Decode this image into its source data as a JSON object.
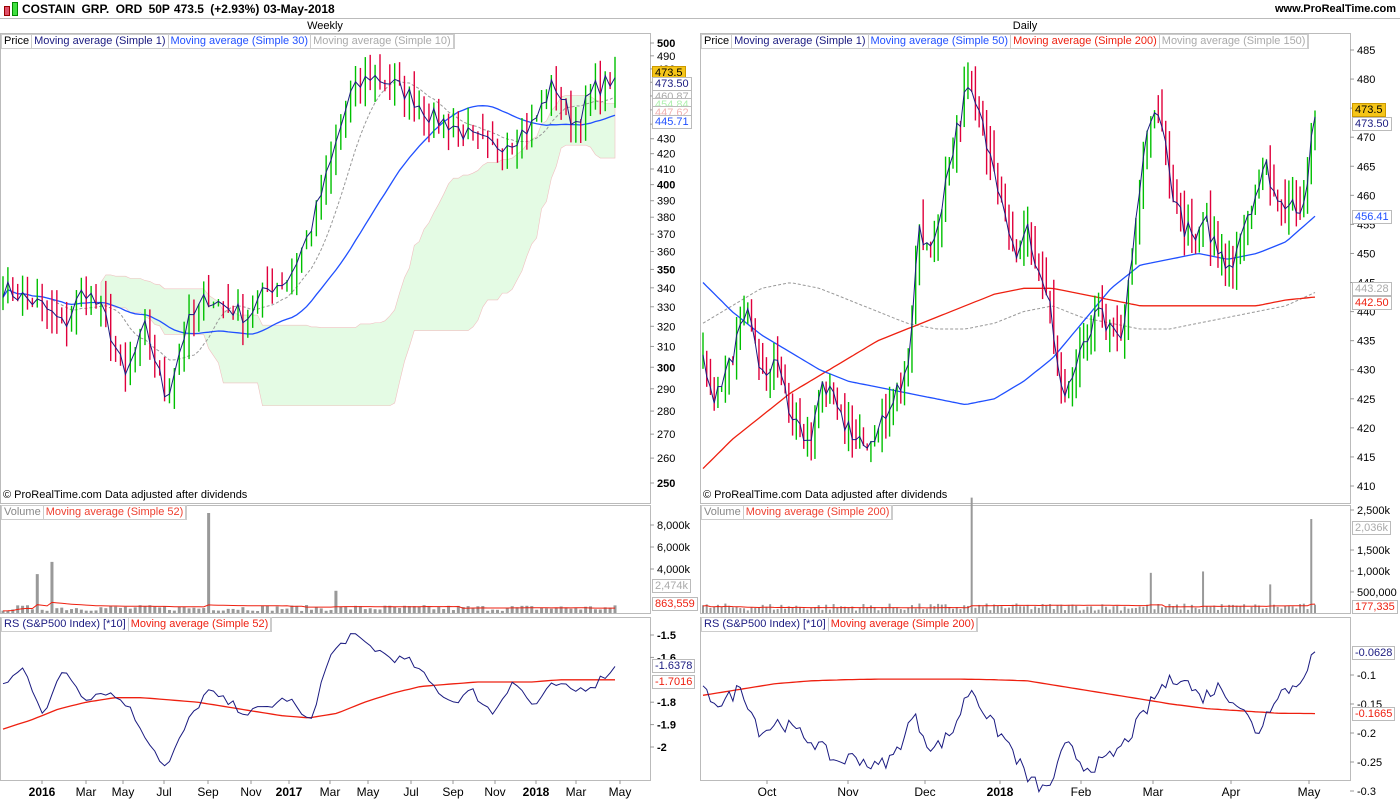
{
  "header": {
    "title": "COSTAIN GRP. ORD 50P",
    "price": "473.5 (+2.93%)",
    "date": "03-May-2018",
    "site": "www.ProRealTime.com"
  },
  "colors": {
    "up": "#00c000",
    "down": "#e0003c",
    "ma1": "#1a1a80",
    "blue": "#2050ff",
    "red": "#ee2010",
    "gray": "#999999",
    "cloud": "#e4fbe4",
    "cloud_red": "#fbe4e4",
    "last": "#f5c518"
  },
  "weekly": {
    "title": "Weekly",
    "legend": [
      "Price",
      "Moving average (Simple 1)",
      "Moving average (Simple 30)",
      "Moving average (Simple 10)"
    ],
    "copyright": "© ProRealTime.com  Data adjusted after dividends",
    "price_ticks": [
      500,
      490,
      480,
      470,
      460,
      450,
      440,
      430,
      420,
      410,
      400,
      390,
      380,
      370,
      360,
      350,
      340,
      330,
      320,
      310,
      300,
      290,
      280,
      270,
      260,
      250
    ],
    "tags": {
      "last": "473.5",
      "ma1": "473.50",
      "ma10": "460.87",
      "span_a": "454.84",
      "span_b": "447.62",
      "ma30": "445.71"
    },
    "volume_legend": [
      "Volume",
      "Moving average (Simple 52)"
    ],
    "volume_ticks": [
      "8,000k",
      "6,000k",
      "4,000k"
    ],
    "volume_tags": {
      "last": "2,474k",
      "ma": "863,559"
    },
    "rs_legend": [
      "RS (S&P500 Index) [*10]",
      "Moving average (Simple 52)"
    ],
    "rs_ticks": [
      "-1.5",
      "-1.6",
      "-1.8",
      "-1.9",
      "-2"
    ],
    "rs_tags": {
      "rs": "-1.6378",
      "ma": "-1.7016"
    },
    "x_labels": [
      "2016",
      "Mar",
      "May",
      "Jul",
      "Sep",
      "Nov",
      "2017",
      "Mar",
      "May",
      "Jul",
      "Sep",
      "Nov",
      "2018",
      "Mar",
      "May"
    ]
  },
  "daily": {
    "title": "Daily",
    "legend": [
      "Price",
      "Moving average (Simple 1)",
      "Moving average (Simple 50)",
      "Moving average (Simple 200)",
      "Moving average (Simple 150)"
    ],
    "copyright": "© ProRealTime.com  Data adjusted after dividends",
    "price_ticks": [
      485,
      480,
      475,
      470,
      465,
      460,
      455,
      450,
      445,
      440,
      435,
      430,
      425,
      420,
      415,
      410
    ],
    "tags": {
      "last": "473.5",
      "ma1": "473.50",
      "ma50": "456.41",
      "ma150": "443.28",
      "ma200": "442.50"
    },
    "volume_legend": [
      "Volume",
      "Moving average (Simple 200)"
    ],
    "volume_ticks": [
      "2,500k",
      "1,500k",
      "1,000k",
      "500,000"
    ],
    "volume_tags": {
      "last": "2,036k",
      "ma": "177,335"
    },
    "rs_legend": [
      "RS (S&P500 Index) [*10]",
      "Moving average (Simple 200)"
    ],
    "rs_ticks": [
      "-0.1",
      "-0.15",
      "-0.2",
      "-0.25",
      "-0.3"
    ],
    "rs_tags": {
      "rs": "-0.0628",
      "ma": "-0.1665"
    },
    "x_labels": [
      "Oct",
      "Nov",
      "Dec",
      "2018",
      "Feb",
      "Mar",
      "Apr",
      "May"
    ]
  },
  "chart_data": [
    {
      "type": "candlestick",
      "name": "weekly",
      "scale": "log",
      "ylim": [
        250,
        500
      ],
      "closes_monthly": [
        340,
        335,
        330,
        320,
        340,
        325,
        295,
        320,
        285,
        320,
        335,
        330,
        325,
        340,
        345,
        370,
        410,
        460,
        475,
        470,
        460,
        445,
        440,
        430,
        425,
        430,
        440,
        470,
        440,
        465,
        473.5
      ],
      "ma30_last": 445.71,
      "ma10_last": 460.87,
      "volume_ylim": [
        0,
        9000000
      ],
      "volume_spikes": {
        "7": 3500000,
        "10": 4600000,
        "42": 9000000,
        "68": 2000000,
        "130": 2474000
      },
      "rs": [
        -1.72,
        -1.65,
        -1.85,
        -1.65,
        -1.78,
        -1.75,
        -1.8,
        -1.95,
        -2.1,
        -1.9,
        -1.75,
        -1.8,
        -1.85,
        -1.82,
        -1.78,
        -1.9,
        -1.6,
        -1.5,
        -1.55,
        -1.6,
        -1.62,
        -1.72,
        -1.8,
        -1.75,
        -1.85,
        -1.7,
        -1.82,
        -1.72,
        -1.75,
        -1.72,
        -1.64
      ],
      "rs_ma": [
        -1.92,
        -1.88,
        -1.83,
        -1.8,
        -1.78,
        -1.78,
        -1.79,
        -1.8,
        -1.82,
        -1.84,
        -1.86,
        -1.87,
        -1.85,
        -1.8,
        -1.76,
        -1.73,
        -1.72,
        -1.71,
        -1.71,
        -1.71,
        -1.7,
        -1.7,
        -1.7
      ]
    },
    {
      "type": "candlestick",
      "name": "daily",
      "scale": "linear",
      "ylim": [
        408,
        487
      ],
      "closes": [
        432,
        425,
        430,
        436,
        440,
        428,
        432,
        425,
        420,
        418,
        428,
        424,
        420,
        418,
        416,
        422,
        426,
        428,
        455,
        450,
        460,
        470,
        478,
        474,
        466,
        460,
        450,
        455,
        446,
        440,
        425,
        430,
        435,
        440,
        436,
        435,
        455,
        470,
        476,
        462,
        455,
        452,
        455,
        450,
        448,
        455,
        460,
        465,
        458,
        460,
        457,
        473.5
      ],
      "ma50": [
        445,
        440,
        436,
        433,
        430,
        428,
        427,
        426,
        425,
        424,
        425,
        428,
        432,
        438,
        444,
        448,
        449,
        450,
        449,
        450,
        452,
        456.41
      ],
      "ma150": [
        438,
        441,
        444,
        445,
        444,
        442,
        440,
        438,
        437,
        437,
        438,
        440,
        441,
        439,
        438,
        437,
        437,
        438,
        439,
        440,
        441,
        443.28
      ],
      "ma200": [
        413,
        418,
        422,
        426,
        429,
        432,
        435,
        437,
        439,
        441,
        443,
        444,
        444,
        443,
        442,
        441,
        441,
        441,
        441,
        441,
        442,
        442.5
      ],
      "volume_ylim": [
        0,
        2600000
      ],
      "volume_spikes": {
        "72": 2500000,
        "120": 870000,
        "134": 900000,
        "152": 620000,
        "163": 2036000
      },
      "rs": [
        -0.13,
        -0.15,
        -0.12,
        -0.2,
        -0.18,
        -0.2,
        -0.22,
        -0.25,
        -0.24,
        -0.26,
        -0.24,
        -0.17,
        -0.23,
        -0.2,
        -0.12,
        -0.18,
        -0.22,
        -0.28,
        -0.3,
        -0.22,
        -0.26,
        -0.25,
        -0.22,
        -0.17,
        -0.12,
        -0.1,
        -0.14,
        -0.12,
        -0.15,
        -0.2,
        -0.13,
        -0.12,
        -0.06
      ],
      "rs_ma": [
        -0.135,
        -0.125,
        -0.115,
        -0.11,
        -0.108,
        -0.107,
        -0.107,
        -0.107,
        -0.108,
        -0.11,
        -0.12,
        -0.13,
        -0.14,
        -0.15,
        -0.158,
        -0.162,
        -0.166,
        -0.1665
      ]
    }
  ]
}
